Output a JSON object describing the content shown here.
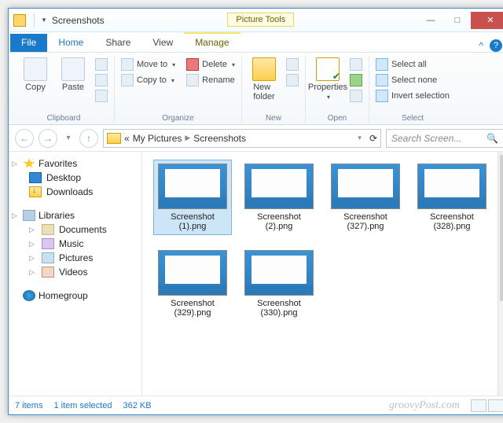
{
  "window": {
    "title": "Screenshots",
    "context_tab_header": "Picture Tools"
  },
  "tabs": {
    "file": "File",
    "home": "Home",
    "share": "Share",
    "view": "View",
    "manage": "Manage"
  },
  "ribbon": {
    "clipboard": {
      "label": "Clipboard",
      "copy": "Copy",
      "paste": "Paste"
    },
    "organize": {
      "label": "Organize",
      "move_to": "Move to",
      "copy_to": "Copy to",
      "delete": "Delete",
      "rename": "Rename"
    },
    "new": {
      "label": "New",
      "new_folder": "New\nfolder"
    },
    "open": {
      "label": "Open",
      "properties": "Properties"
    },
    "select": {
      "label": "Select",
      "select_all": "Select all",
      "select_none": "Select none",
      "invert": "Invert selection"
    }
  },
  "address": {
    "crumbs": [
      "My Pictures",
      "Screenshots"
    ],
    "search_placeholder": "Search Screen..."
  },
  "nav": {
    "favorites": {
      "label": "Favorites",
      "items": [
        "Desktop",
        "Downloads"
      ]
    },
    "libraries": {
      "label": "Libraries",
      "items": [
        "Documents",
        "Music",
        "Pictures",
        "Videos"
      ]
    },
    "homegroup": {
      "label": "Homegroup"
    }
  },
  "files": [
    {
      "name": "Screenshot (1).png",
      "selected": true
    },
    {
      "name": "Screenshot (2).png",
      "selected": false
    },
    {
      "name": "Screenshot (327).png",
      "selected": false
    },
    {
      "name": "Screenshot (328).png",
      "selected": false
    },
    {
      "name": "Screenshot (329).png",
      "selected": false
    },
    {
      "name": "Screenshot (330).png",
      "selected": false
    }
  ],
  "status": {
    "count": "7 items",
    "selected": "1 item selected",
    "size": "362 KB"
  },
  "watermark": "groovyPost.com"
}
